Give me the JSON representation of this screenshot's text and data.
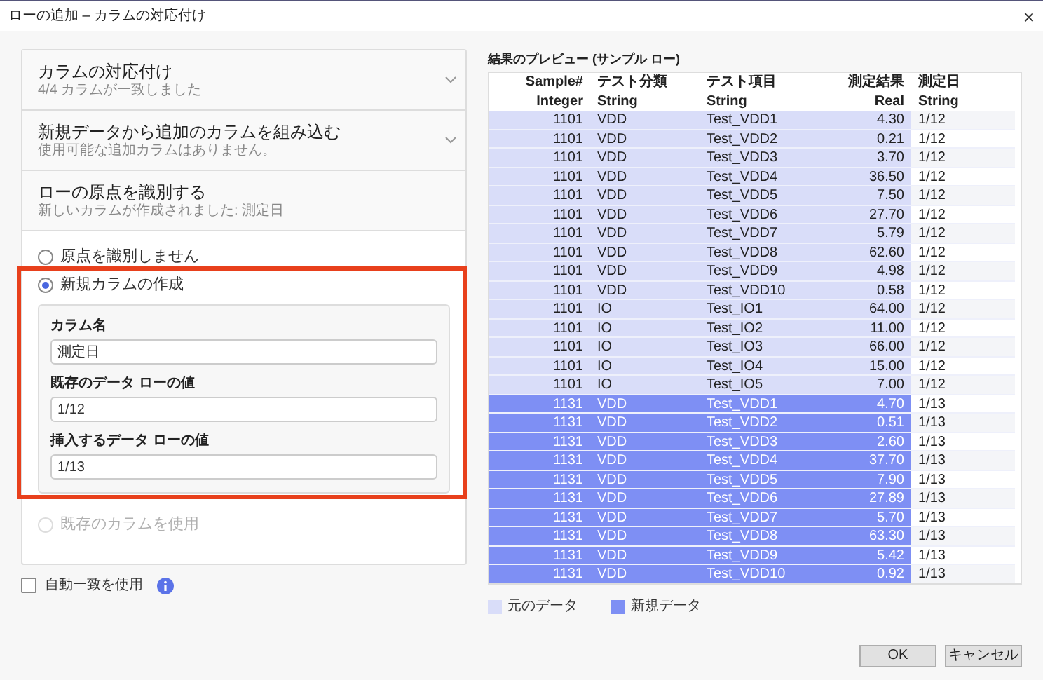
{
  "window": {
    "title": "ローの追加 – カラムの対応付け",
    "close": "×"
  },
  "sections": [
    {
      "title": "カラムの対応付け",
      "subtitle": "4/4 カラムが一致しました",
      "expanded": false
    },
    {
      "title": "新規データから追加のカラムを組み込む",
      "subtitle": "使用可能な追加カラムはありません。",
      "expanded": false
    },
    {
      "title": "ローの原点を識別する",
      "subtitle": "新しいカラムが作成されました: 測定日",
      "expanded": true
    }
  ],
  "options": [
    {
      "label": "原点を識別しません",
      "selected": false,
      "disabled": false
    },
    {
      "label": "新規カラムの作成",
      "selected": true,
      "disabled": false,
      "highlighted": true,
      "fields": [
        {
          "label": "カラム名",
          "value": "測定日"
        },
        {
          "label": "既存のデータ ローの値",
          "value": "1/12"
        },
        {
          "label": "挿入するデータ ローの値",
          "value": "1/13"
        }
      ]
    },
    {
      "label": "既存のカラムを使用",
      "selected": false,
      "disabled": true
    }
  ],
  "auto_match": {
    "label": "自動一致を使用",
    "checked": false
  },
  "preview": {
    "title": "結果のプレビュー (サンプル ロー)",
    "columns": [
      {
        "name": "Sample#",
        "type": "Integer"
      },
      {
        "name": "テスト分類",
        "type": "String"
      },
      {
        "name": "テスト項目",
        "type": "String"
      },
      {
        "name": "測定結果",
        "type": "Real"
      },
      {
        "name": "測定日",
        "type": "String"
      }
    ],
    "rows": [
      {
        "kind": "original",
        "cells": [
          "1101",
          "VDD",
          "Test_VDD1",
          "4.30",
          "1/12"
        ]
      },
      {
        "kind": "original",
        "cells": [
          "1101",
          "VDD",
          "Test_VDD2",
          "0.21",
          "1/12"
        ]
      },
      {
        "kind": "original",
        "cells": [
          "1101",
          "VDD",
          "Test_VDD3",
          "3.70",
          "1/12"
        ]
      },
      {
        "kind": "original",
        "cells": [
          "1101",
          "VDD",
          "Test_VDD4",
          "36.50",
          "1/12"
        ]
      },
      {
        "kind": "original",
        "cells": [
          "1101",
          "VDD",
          "Test_VDD5",
          "7.50",
          "1/12"
        ]
      },
      {
        "kind": "original",
        "cells": [
          "1101",
          "VDD",
          "Test_VDD6",
          "27.70",
          "1/12"
        ]
      },
      {
        "kind": "original",
        "cells": [
          "1101",
          "VDD",
          "Test_VDD7",
          "5.79",
          "1/12"
        ]
      },
      {
        "kind": "original",
        "cells": [
          "1101",
          "VDD",
          "Test_VDD8",
          "62.60",
          "1/12"
        ]
      },
      {
        "kind": "original",
        "cells": [
          "1101",
          "VDD",
          "Test_VDD9",
          "4.98",
          "1/12"
        ]
      },
      {
        "kind": "original",
        "cells": [
          "1101",
          "VDD",
          "Test_VDD10",
          "0.58",
          "1/12"
        ]
      },
      {
        "kind": "original",
        "cells": [
          "1101",
          "IO",
          "Test_IO1",
          "64.00",
          "1/12"
        ]
      },
      {
        "kind": "original",
        "cells": [
          "1101",
          "IO",
          "Test_IO2",
          "11.00",
          "1/12"
        ]
      },
      {
        "kind": "original",
        "cells": [
          "1101",
          "IO",
          "Test_IO3",
          "66.00",
          "1/12"
        ]
      },
      {
        "kind": "original",
        "cells": [
          "1101",
          "IO",
          "Test_IO4",
          "15.00",
          "1/12"
        ]
      },
      {
        "kind": "original",
        "cells": [
          "1101",
          "IO",
          "Test_IO5",
          "7.00",
          "1/12"
        ]
      },
      {
        "kind": "new",
        "cells": [
          "1131",
          "VDD",
          "Test_VDD1",
          "4.70",
          "1/13"
        ]
      },
      {
        "kind": "new",
        "cells": [
          "1131",
          "VDD",
          "Test_VDD2",
          "0.51",
          "1/13"
        ]
      },
      {
        "kind": "new",
        "cells": [
          "1131",
          "VDD",
          "Test_VDD3",
          "2.60",
          "1/13"
        ]
      },
      {
        "kind": "new",
        "cells": [
          "1131",
          "VDD",
          "Test_VDD4",
          "37.70",
          "1/13"
        ]
      },
      {
        "kind": "new",
        "cells": [
          "1131",
          "VDD",
          "Test_VDD5",
          "7.90",
          "1/13"
        ]
      },
      {
        "kind": "new",
        "cells": [
          "1131",
          "VDD",
          "Test_VDD6",
          "27.89",
          "1/13"
        ]
      },
      {
        "kind": "new",
        "cells": [
          "1131",
          "VDD",
          "Test_VDD7",
          "5.70",
          "1/13"
        ]
      },
      {
        "kind": "new",
        "cells": [
          "1131",
          "VDD",
          "Test_VDD8",
          "63.30",
          "1/13"
        ]
      },
      {
        "kind": "new",
        "cells": [
          "1131",
          "VDD",
          "Test_VDD9",
          "5.42",
          "1/13"
        ]
      },
      {
        "kind": "new",
        "cells": [
          "1131",
          "VDD",
          "Test_VDD10",
          "0.92",
          "1/13"
        ]
      }
    ],
    "legend": [
      {
        "kind": "original",
        "label": "元のデータ"
      },
      {
        "kind": "new",
        "label": "新規データ"
      }
    ]
  },
  "buttons": [
    "OK",
    "キャンセル"
  ]
}
